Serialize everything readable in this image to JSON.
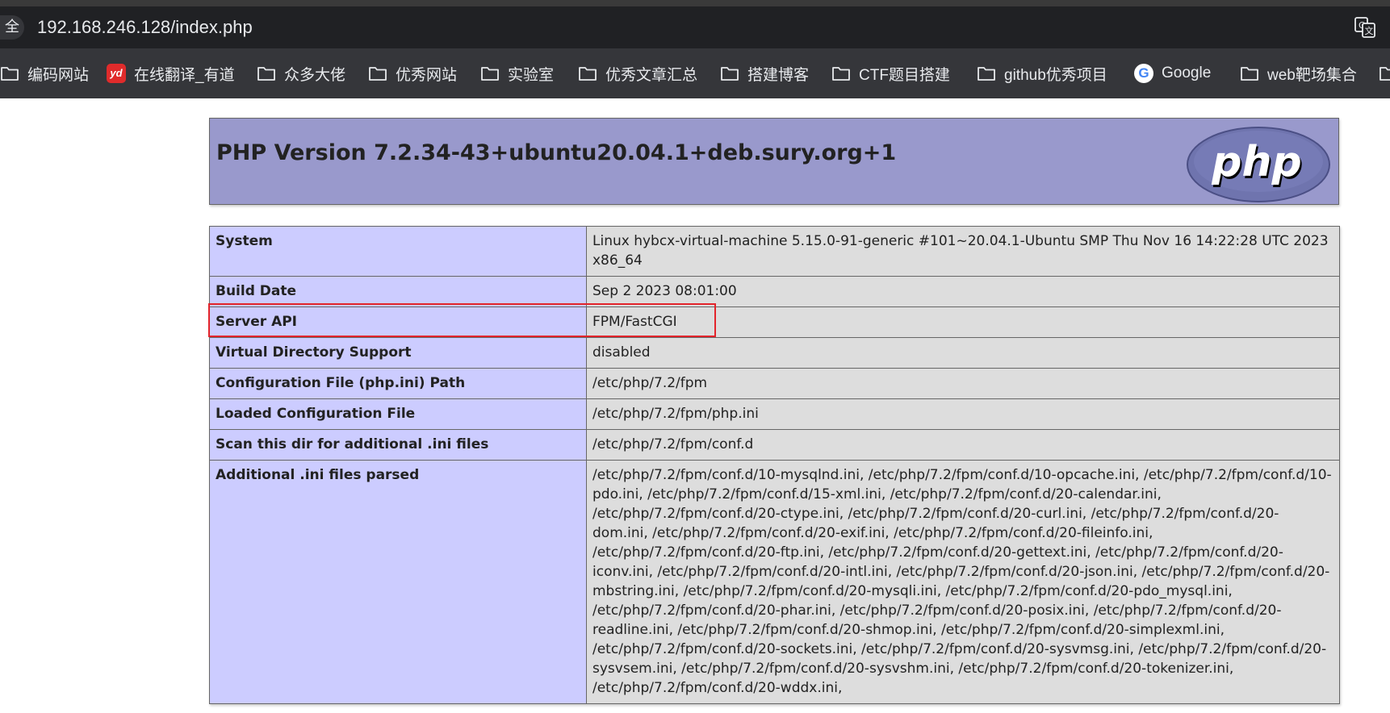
{
  "browser": {
    "security_label": "全",
    "url": "192.168.246.128/index.php",
    "bookmarks": [
      {
        "label": "编码网站",
        "icon": "folder-icon"
      },
      {
        "label": "在线翻译_有道",
        "icon": "youdao-icon"
      },
      {
        "label": "众多大佬",
        "icon": "folder-icon"
      },
      {
        "label": "优秀网站",
        "icon": "folder-icon"
      },
      {
        "label": "实验室",
        "icon": "folder-icon"
      },
      {
        "label": "优秀文章汇总",
        "icon": "folder-icon"
      },
      {
        "label": "搭建博客",
        "icon": "folder-icon"
      },
      {
        "label": "CTF题目搭建",
        "icon": "folder-icon"
      },
      {
        "label": "github优秀项目",
        "icon": "folder-icon"
      },
      {
        "label": "Google",
        "icon": "google-icon"
      },
      {
        "label": "web靶场集合",
        "icon": "folder-icon"
      }
    ]
  },
  "phpinfo": {
    "title": "PHP Version 7.2.34-43+ubuntu20.04.1+deb.sury.org+1",
    "logo_text": "php",
    "rows": [
      {
        "key": "System",
        "value": "Linux hybcx-virtual-machine 5.15.0-91-generic #101~20.04.1-Ubuntu SMP Thu Nov 16 14:22:28 UTC 2023 x86_64"
      },
      {
        "key": "Build Date",
        "value": "Sep 2 2023 08:01:00"
      },
      {
        "key": "Server API",
        "value": "FPM/FastCGI"
      },
      {
        "key": "Virtual Directory Support",
        "value": "disabled"
      },
      {
        "key": "Configuration File (php.ini) Path",
        "value": "/etc/php/7.2/fpm"
      },
      {
        "key": "Loaded Configuration File",
        "value": "/etc/php/7.2/fpm/php.ini"
      },
      {
        "key": "Scan this dir for additional .ini files",
        "value": "/etc/php/7.2/fpm/conf.d"
      },
      {
        "key": "Additional .ini files parsed",
        "value": "/etc/php/7.2/fpm/conf.d/10-mysqlnd.ini, /etc/php/7.2/fpm/conf.d/10-opcache.ini, /etc/php/7.2/fpm/conf.d/10-pdo.ini, /etc/php/7.2/fpm/conf.d/15-xml.ini, /etc/php/7.2/fpm/conf.d/20-calendar.ini, /etc/php/7.2/fpm/conf.d/20-ctype.ini, /etc/php/7.2/fpm/conf.d/20-curl.ini, /etc/php/7.2/fpm/conf.d/20-dom.ini, /etc/php/7.2/fpm/conf.d/20-exif.ini, /etc/php/7.2/fpm/conf.d/20-fileinfo.ini, /etc/php/7.2/fpm/conf.d/20-ftp.ini, /etc/php/7.2/fpm/conf.d/20-gettext.ini, /etc/php/7.2/fpm/conf.d/20-iconv.ini, /etc/php/7.2/fpm/conf.d/20-intl.ini, /etc/php/7.2/fpm/conf.d/20-json.ini, /etc/php/7.2/fpm/conf.d/20-mbstring.ini, /etc/php/7.2/fpm/conf.d/20-mysqli.ini, /etc/php/7.2/fpm/conf.d/20-pdo_mysql.ini, /etc/php/7.2/fpm/conf.d/20-phar.ini, /etc/php/7.2/fpm/conf.d/20-posix.ini, /etc/php/7.2/fpm/conf.d/20-readline.ini, /etc/php/7.2/fpm/conf.d/20-shmop.ini, /etc/php/7.2/fpm/conf.d/20-simplexml.ini, /etc/php/7.2/fpm/conf.d/20-sockets.ini, /etc/php/7.2/fpm/conf.d/20-sysvmsg.ini, /etc/php/7.2/fpm/conf.d/20-sysvsem.ini, /etc/php/7.2/fpm/conf.d/20-sysvshm.ini, /etc/php/7.2/fpm/conf.d/20-tokenizer.ini, /etc/php/7.2/fpm/conf.d/20-wddx.ini,"
      }
    ]
  },
  "colors": {
    "header_bg": "#9999cc",
    "key_cell_bg": "#ccccff",
    "value_cell_bg": "#dddddd",
    "highlight_border": "#e3242b"
  }
}
